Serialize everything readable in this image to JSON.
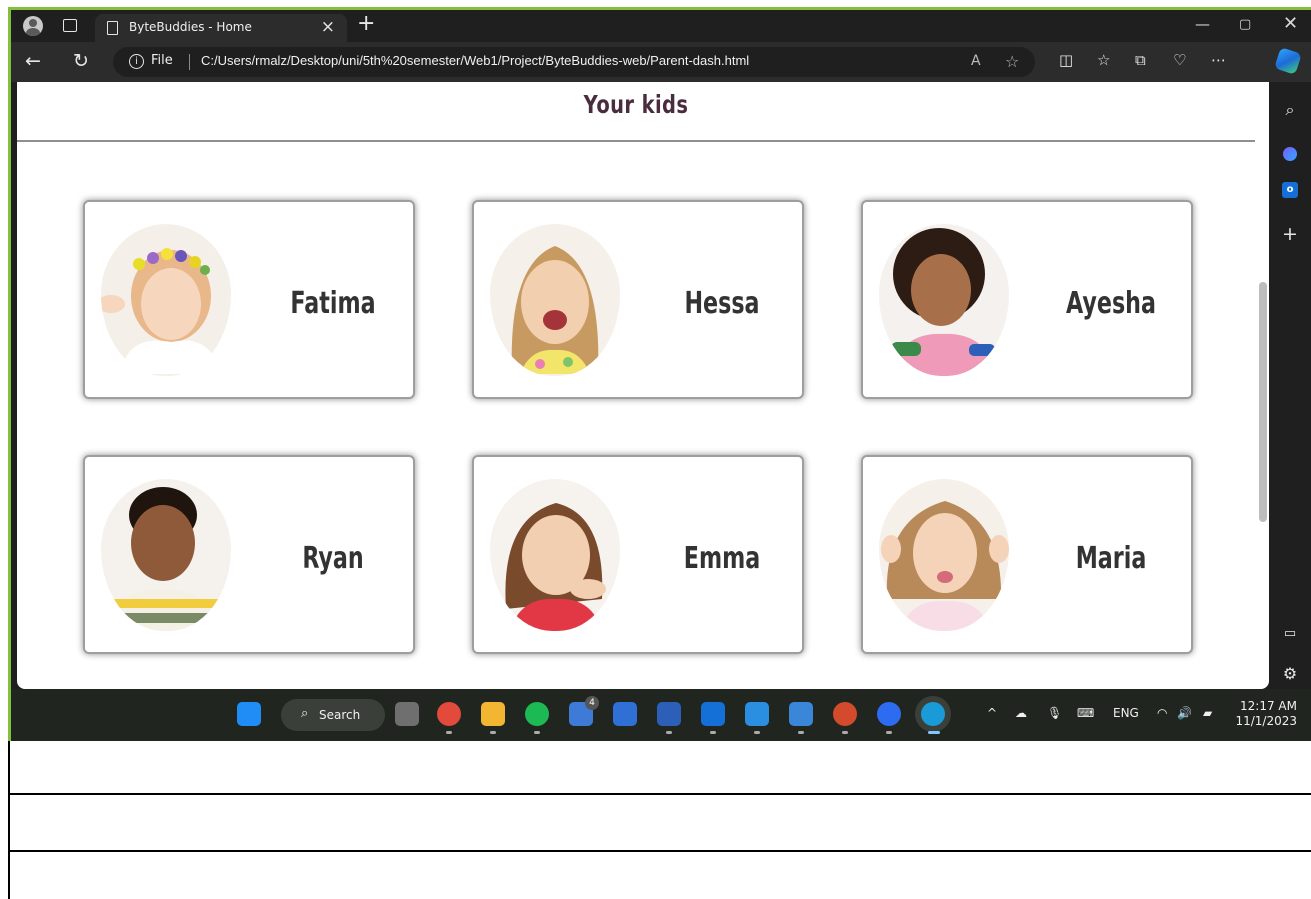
{
  "browser": {
    "tab_title": "ByteBuddies - Home",
    "address": {
      "scheme_label": "File",
      "url": "C:/Users/rmalz/Desktop/uni/5th%20semester/Web1/Project/ByteBuddies-web/Parent-dash.html"
    }
  },
  "page": {
    "title": "Your kids",
    "kids": [
      {
        "name": "Fatima"
      },
      {
        "name": "Hessa"
      },
      {
        "name": "Ayesha"
      },
      {
        "name": "Ryan"
      },
      {
        "name": "Emma"
      },
      {
        "name": "Maria"
      }
    ]
  },
  "taskbar": {
    "search_label": "Search",
    "language": "ENG",
    "time": "12:17 AM",
    "date": "11/1/2023",
    "badge_count": "4"
  },
  "colors": {
    "bezel": "#84c13b",
    "title_text": "#4a2d3d",
    "card_border": "#9e9e9e",
    "browser_chrome": "#1f1f1f"
  }
}
